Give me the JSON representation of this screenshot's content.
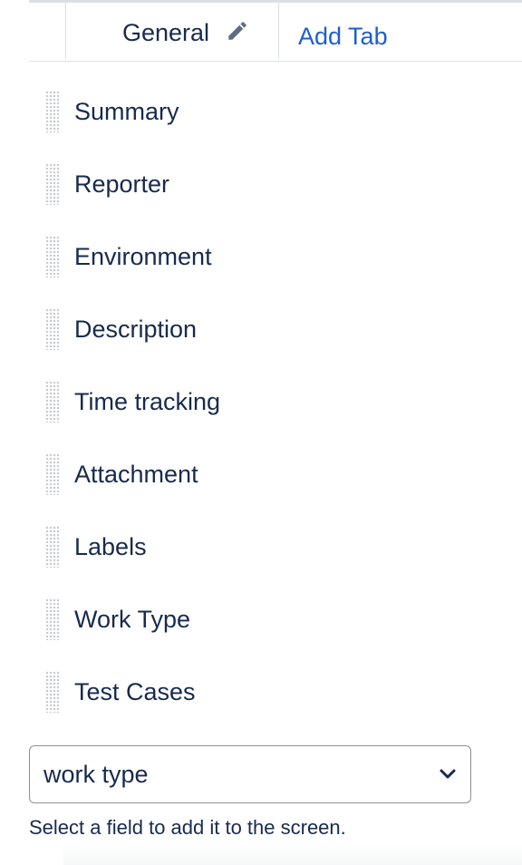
{
  "tabs": {
    "active_label": "General",
    "add_label": "Add Tab",
    "edit_icon": "pencil-icon"
  },
  "fields": [
    {
      "label": "Summary"
    },
    {
      "label": "Reporter"
    },
    {
      "label": "Environment"
    },
    {
      "label": "Description"
    },
    {
      "label": "Time tracking"
    },
    {
      "label": "Attachment"
    },
    {
      "label": "Labels"
    },
    {
      "label": "Work Type"
    },
    {
      "label": "Test Cases"
    }
  ],
  "field_select": {
    "value": "work type",
    "icon": "chevron-down-icon"
  },
  "helper": {
    "text": "Select a field to add it to the screen."
  },
  "colors": {
    "link": "#1d5fcf",
    "text": "#172b4d",
    "border": "#dcdfe4"
  }
}
